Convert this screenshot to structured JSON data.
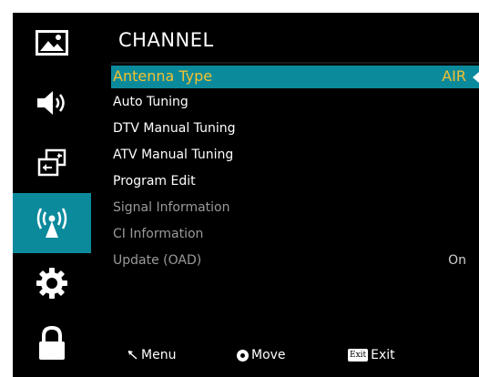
{
  "sidebar": {
    "items": [
      {
        "name": "picture",
        "icon": "picture-icon",
        "active": false
      },
      {
        "name": "sound",
        "icon": "speaker-icon",
        "active": false
      },
      {
        "name": "source",
        "icon": "input-source-icon",
        "active": false
      },
      {
        "name": "channel",
        "icon": "antenna-signal-icon",
        "active": true
      },
      {
        "name": "setup",
        "icon": "gear-icon",
        "active": false
      },
      {
        "name": "lock",
        "icon": "lock-icon",
        "active": false
      }
    ]
  },
  "menu": {
    "title": "CHANNEL",
    "items": [
      {
        "label": "Antenna Type",
        "value": "AIR",
        "state": "selected"
      },
      {
        "label": "Auto Tuning",
        "value": "",
        "state": "enabled"
      },
      {
        "label": "DTV Manual Tuning",
        "value": "",
        "state": "enabled"
      },
      {
        "label": "ATV Manual Tuning",
        "value": "",
        "state": "enabled"
      },
      {
        "label": "Program Edit",
        "value": "",
        "state": "enabled"
      },
      {
        "label": "Signal Information",
        "value": "",
        "state": "disabled"
      },
      {
        "label": "CI Information",
        "value": "",
        "state": "disabled"
      },
      {
        "label": "Update (OAD)",
        "value": "On",
        "state": "disabled"
      }
    ]
  },
  "footer": {
    "menu_label": "Menu",
    "move_label": "Move",
    "exit_badge": "Exit",
    "exit_label": "Exit"
  },
  "colors": {
    "accent": "#0b8a9c",
    "highlight_text": "#f2c12e",
    "disabled_text": "#9a9a9a",
    "background": "#000000"
  }
}
